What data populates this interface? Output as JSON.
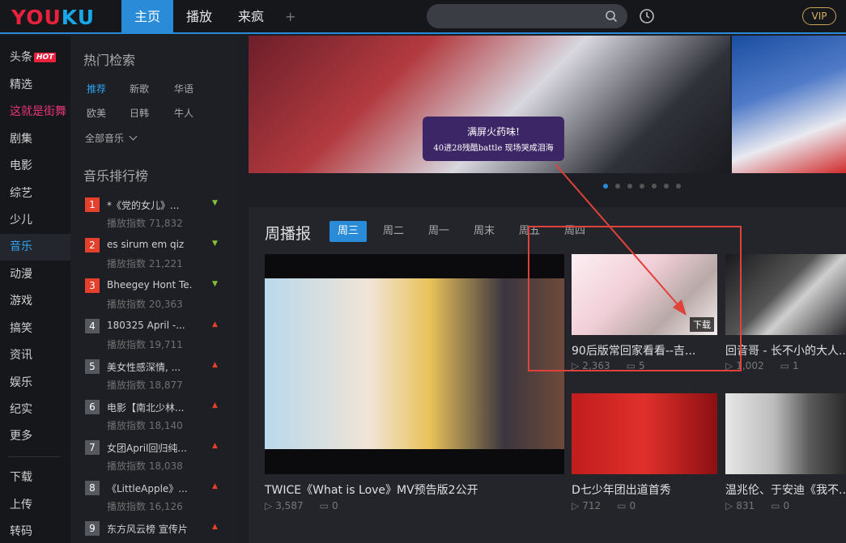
{
  "header": {
    "logo": {
      "part1": "YOU",
      "part2": "KU"
    },
    "tabs": [
      {
        "label": "主页",
        "active": true
      },
      {
        "label": "播放",
        "active": false
      },
      {
        "label": "来疯",
        "active": false
      }
    ],
    "add_tab": "+",
    "search": {
      "placeholder": "",
      "value": ""
    },
    "vip": "VIP",
    "accent_color": "#2a8bd8"
  },
  "leftnav": {
    "items": [
      {
        "label": "头条",
        "badge": "HOT"
      },
      {
        "label": "精选"
      },
      {
        "label": "这就是街舞",
        "highlight": true
      },
      {
        "label": "剧集"
      },
      {
        "label": "电影"
      },
      {
        "label": "综艺"
      },
      {
        "label": "少儿"
      },
      {
        "label": "音乐",
        "active": true
      },
      {
        "label": "动漫"
      },
      {
        "label": "游戏"
      },
      {
        "label": "搞笑"
      },
      {
        "label": "资讯"
      },
      {
        "label": "娱乐"
      },
      {
        "label": "纪实"
      },
      {
        "label": "更多"
      }
    ],
    "bottom_items": [
      {
        "label": "下载"
      },
      {
        "label": "上传"
      },
      {
        "label": "转码"
      }
    ]
  },
  "sidebar": {
    "hot_search_title": "热门检索",
    "genres": [
      "推荐",
      "新歌",
      "华语",
      "欧美",
      "日韩",
      "牛人"
    ],
    "all_music": "全部音乐",
    "chart_title": "音乐排行榜",
    "rankings": [
      {
        "num": "1",
        "title": "*《党的女儿》...",
        "plays": "播放指数 71,832",
        "trend": "down"
      },
      {
        "num": "2",
        "title": "es sirum em qiz",
        "plays": "播放指数 21,221",
        "trend": "down"
      },
      {
        "num": "3",
        "title": "Bheegey Hont Te...",
        "plays": "播放指数 20,363",
        "trend": "down"
      },
      {
        "num": "4",
        "title": "180325 April -...",
        "plays": "播放指数 19,711",
        "trend": "up"
      },
      {
        "num": "5",
        "title": "美女性感深情, ...",
        "plays": "播放指数 18,877",
        "trend": "up"
      },
      {
        "num": "6",
        "title": "电影【南北少林...",
        "plays": "播放指数 18,140",
        "trend": "up"
      },
      {
        "num": "7",
        "title": "女团April回归纯...",
        "plays": "播放指数 18,038",
        "trend": "up"
      },
      {
        "num": "8",
        "title": "《LittleApple》...",
        "plays": "播放指数 16,126",
        "trend": "up"
      },
      {
        "num": "9",
        "title": "东方风云榜 宣传片",
        "plays": "",
        "trend": "up"
      }
    ]
  },
  "banner": {
    "badge_line1": "满屏火药味!",
    "badge_line2": "40进28残酷battle 现场哭成泪海",
    "dots": 7,
    "active_dot": 0
  },
  "weekly": {
    "title": "周播报",
    "tabs": [
      "周三",
      "周二",
      "周一",
      "周末",
      "周五",
      "周四"
    ],
    "big": {
      "caption": "TWICE《What is Love》MV预告版2公开",
      "views": "3,587",
      "comments": "0"
    },
    "items": [
      {
        "caption": "90后版常回家看看--吉...",
        "views": "2,363",
        "comments": "5",
        "badge": "下载"
      },
      {
        "caption": "回音哥 - 长不小的大人...",
        "views": "1,002",
        "comments": "1"
      },
      {
        "caption": "D七少年团出道首秀",
        "views": "712",
        "comments": "0"
      },
      {
        "caption": "温兆伦、于安迪《我不...",
        "views": "831",
        "comments": "0"
      }
    ]
  },
  "annotation_color": "#e0423a"
}
